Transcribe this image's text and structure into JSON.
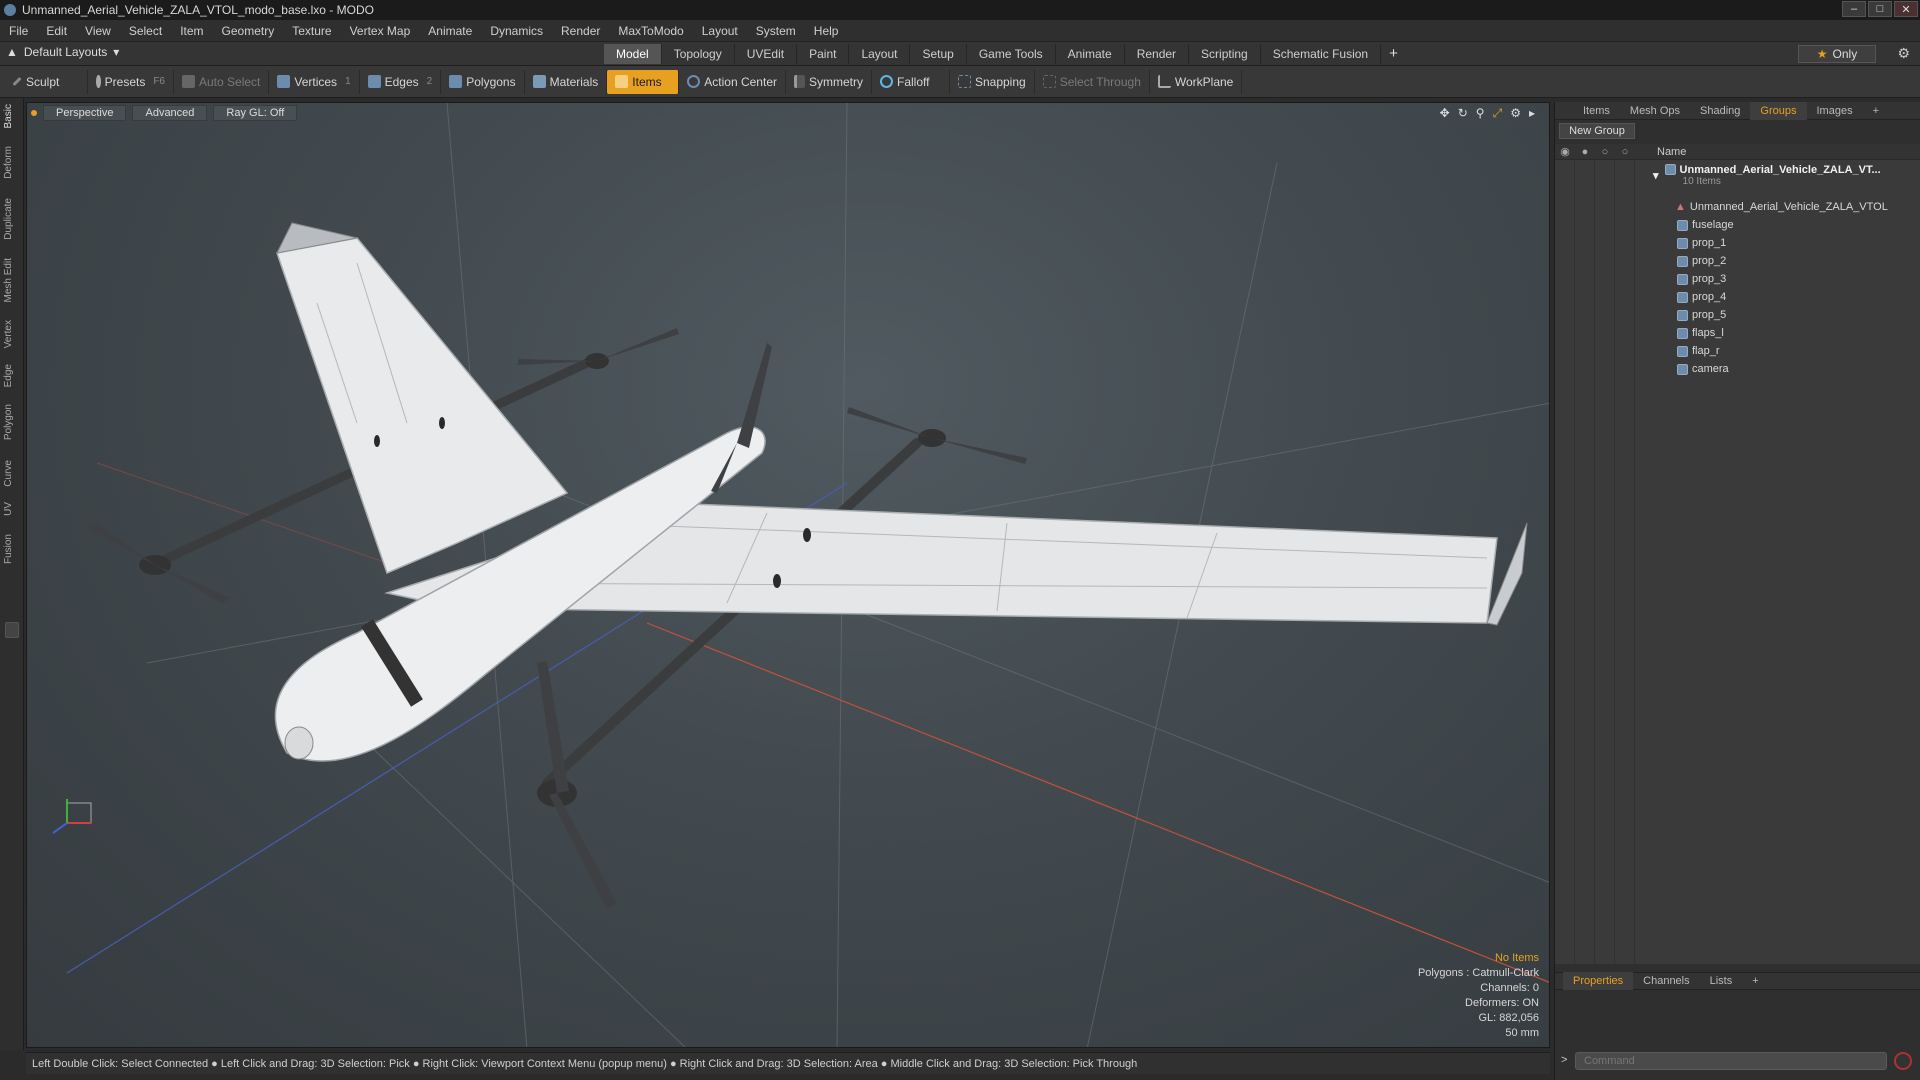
{
  "window": {
    "title": "Unmanned_Aerial_Vehicle_ZALA_VTOL_modo_base.lxo - MODO"
  },
  "menu": [
    "File",
    "Edit",
    "View",
    "Select",
    "Item",
    "Geometry",
    "Texture",
    "Vertex Map",
    "Animate",
    "Dynamics",
    "Render",
    "MaxToModo",
    "Layout",
    "System",
    "Help"
  ],
  "layout": {
    "selector": "Default Layouts",
    "tabs": [
      "Model",
      "Topology",
      "UVEdit",
      "Paint",
      "Layout",
      "Setup",
      "Game Tools",
      "Animate",
      "Render",
      "Scripting",
      "Schematic Fusion"
    ],
    "active_tab": "Model",
    "only_label": "Only"
  },
  "toolbar": {
    "sculpt": "Sculpt",
    "presets": "Presets",
    "presets_key": "F6",
    "auto_select": "Auto Select",
    "vertices": "Vertices",
    "vertices_count": "1",
    "edges": "Edges",
    "edges_count": "2",
    "polygons": "Polygons",
    "materials": "Materials",
    "items": "Items",
    "action_center": "Action Center",
    "symmetry": "Symmetry",
    "falloff": "Falloff",
    "snapping": "Snapping",
    "select_through": "Select Through",
    "workplane": "WorkPlane"
  },
  "left_tabs": [
    "Basic",
    "Deform",
    "Duplicate",
    "Mesh Edit",
    "Vertex",
    "Edge",
    "Polygon",
    "Curve",
    "UV",
    "Fusion"
  ],
  "viewport": {
    "perspective": "Perspective",
    "advanced": "Advanced",
    "raygl": "Ray GL: Off",
    "stats": {
      "no_items": "No Items",
      "polygons": "Polygons : Catmull-Clark",
      "channels": "Channels: 0",
      "deformers": "Deformers: ON",
      "gl": "GL: 882,056",
      "scale": "50 mm"
    }
  },
  "status": "Left Double Click: Select Connected ● Left Click and Drag: 3D Selection: Pick ● Right Click: Viewport Context Menu (popup menu) ● Right Click and Drag: 3D Selection: Area ● Middle Click and Drag: 3D Selection: Pick Through",
  "right_panel": {
    "tabs": [
      "Items",
      "Mesh Ops",
      "Shading",
      "Groups",
      "Images"
    ],
    "active_tab": "Groups",
    "new_group": "New Group",
    "name_col": "Name",
    "root": {
      "name": "Unmanned_Aerial_Vehicle_ZALA_VT...",
      "sub": "10 Items"
    },
    "items": [
      "Unmanned_Aerial_Vehicle_ZALA_VTOL",
      "fuselage",
      "prop_1",
      "prop_2",
      "prop_3",
      "prop_4",
      "prop_5",
      "flaps_l",
      "flap_r",
      "camera"
    ],
    "props_tabs": [
      "Properties",
      "Channels",
      "Lists"
    ],
    "command_placeholder": "Command"
  },
  "colors": {
    "accent": "#e8a020",
    "viewport_bg": "#434b50"
  }
}
